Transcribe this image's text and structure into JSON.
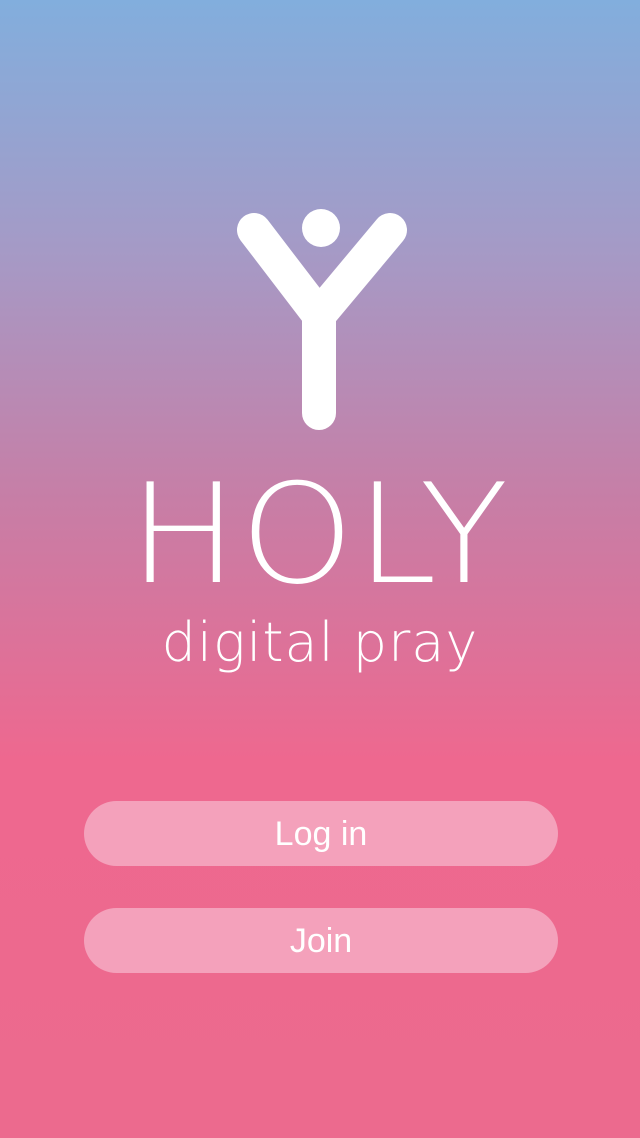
{
  "brand": {
    "title": "HOLY",
    "subtitle": "digital pray",
    "logo_icon": "person-arms-raised-icon"
  },
  "actions": {
    "login_label": "Log in",
    "join_label": "Join"
  },
  "colors": {
    "gradient_top": "#82aedd",
    "gradient_mid": "#c77ea6",
    "gradient_bottom": "#ec6a8e",
    "button_fill": "#f4a1bb",
    "text": "#ffffff"
  }
}
